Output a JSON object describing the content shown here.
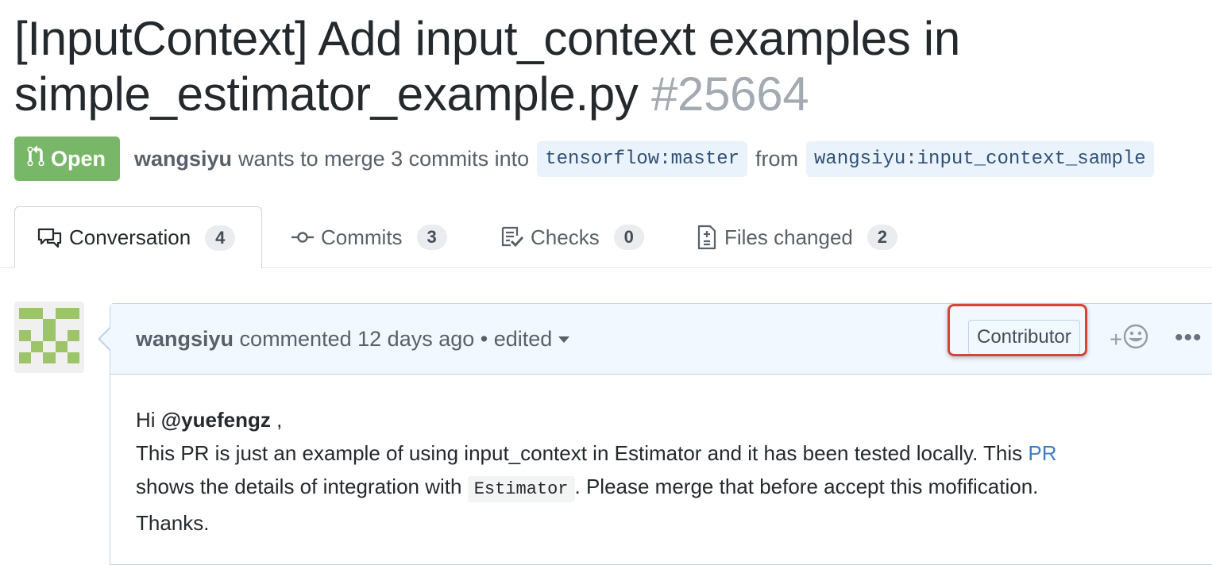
{
  "pr": {
    "title": "[InputContext] Add input_context examples in simple_estimator_example.py",
    "number": "#25664",
    "state": "Open",
    "state_color": "#79b768",
    "author": "wangsiyu",
    "merge_text": "wants to merge 3 commits into",
    "base_branch": "tensorflow:master",
    "from_text": "from",
    "head_branch": "wangsiyu:input_context_sample"
  },
  "tabs": [
    {
      "label": "Conversation",
      "count": "4",
      "icon": "comment-discussion-icon",
      "selected": true
    },
    {
      "label": "Commits",
      "count": "3",
      "icon": "git-commit-icon",
      "selected": false
    },
    {
      "label": "Checks",
      "count": "0",
      "icon": "checklist-icon",
      "selected": false
    },
    {
      "label": "Files changed",
      "count": "2",
      "icon": "file-diff-icon",
      "selected": false
    }
  ],
  "comment": {
    "author": "wangsiyu",
    "action": "commented",
    "time": "12 days ago",
    "bullet": "•",
    "edited": "edited",
    "role_badge": "Contributor",
    "highlight_color": "#d4463a",
    "reaction_plus": "+",
    "more": "•••",
    "body": {
      "greeting": "Hi",
      "mention": "@yuefengz",
      "greeting_end": " ,",
      "line1": "This PR is just an example of using input_context in Estimator and it has been tested locally. This ",
      "link": "PR",
      "line2a": "shows the details of integration with ",
      "code": "Estimator",
      "line2b": ". Please merge that before accept this mofification.",
      "line3": "Thanks."
    }
  }
}
